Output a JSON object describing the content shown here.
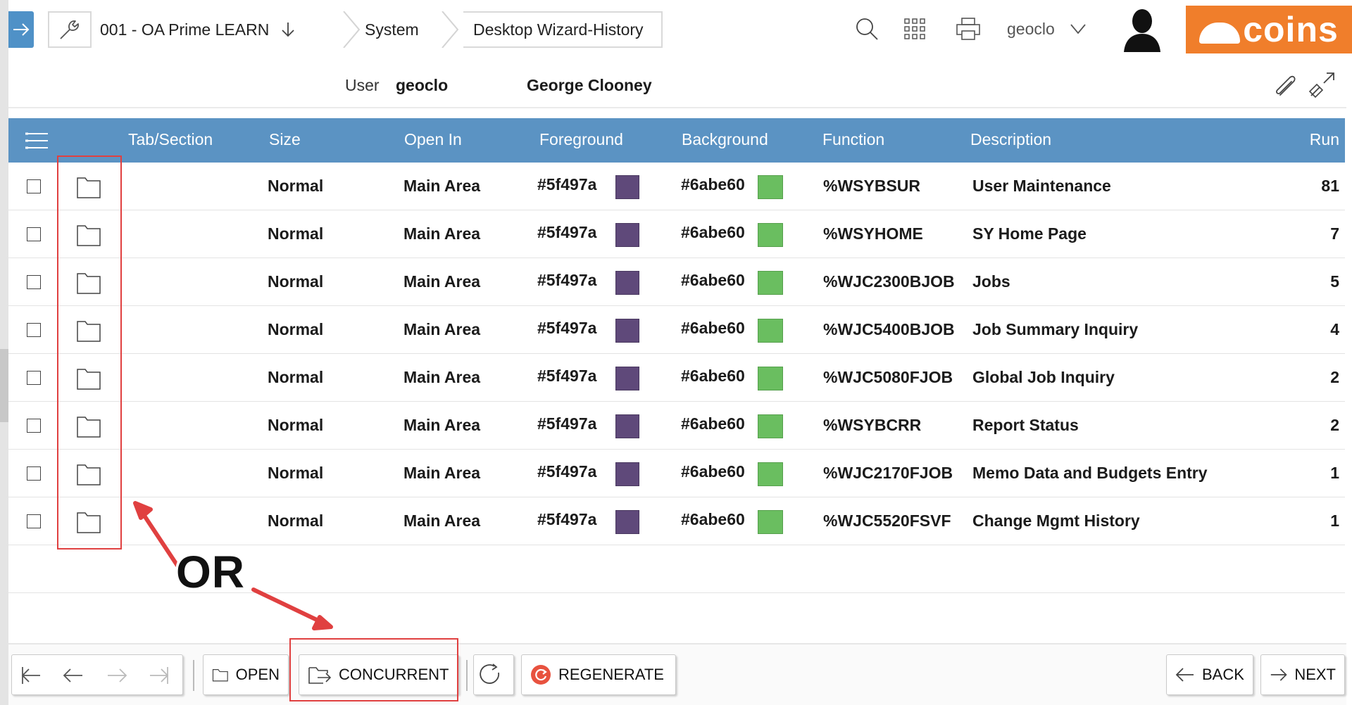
{
  "breadcrumb": {
    "company": "001 - OA Prime LEARN",
    "module": "System",
    "page": "Desktop Wizard-History"
  },
  "header": {
    "user_code": "geoclo",
    "brand": "coins"
  },
  "info": {
    "user_label": "User",
    "user_code": "geoclo",
    "user_name": "George Clooney"
  },
  "grid": {
    "columns": [
      "Tab/Section",
      "Size",
      "Open In",
      "Foreground",
      "Background",
      "Function",
      "Description",
      "Run"
    ],
    "rows": [
      {
        "size": "Normal",
        "open_in": "Main Area",
        "foreground": "#5f497a",
        "background": "#6abe60",
        "function": "%WSYBSUR",
        "description": "User Maintenance",
        "run": "81"
      },
      {
        "size": "Normal",
        "open_in": "Main Area",
        "foreground": "#5f497a",
        "background": "#6abe60",
        "function": "%WSYHOME",
        "description": "SY Home Page",
        "run": "7"
      },
      {
        "size": "Normal",
        "open_in": "Main Area",
        "foreground": "#5f497a",
        "background": "#6abe60",
        "function": "%WJC2300BJOB",
        "description": "Jobs",
        "run": "5"
      },
      {
        "size": "Normal",
        "open_in": "Main Area",
        "foreground": "#5f497a",
        "background": "#6abe60",
        "function": "%WJC5400BJOB",
        "description": "Job Summary Inquiry",
        "run": "4"
      },
      {
        "size": "Normal",
        "open_in": "Main Area",
        "foreground": "#5f497a",
        "background": "#6abe60",
        "function": "%WJC5080FJOB",
        "description": "Global Job Inquiry",
        "run": "2"
      },
      {
        "size": "Normal",
        "open_in": "Main Area",
        "foreground": "#5f497a",
        "background": "#6abe60",
        "function": "%WSYBCRR",
        "description": "Report Status",
        "run": "2"
      },
      {
        "size": "Normal",
        "open_in": "Main Area",
        "foreground": "#5f497a",
        "background": "#6abe60",
        "function": "%WJC2170FJOB",
        "description": "Memo Data and Budgets Entry",
        "run": "1"
      },
      {
        "size": "Normal",
        "open_in": "Main Area",
        "foreground": "#5f497a",
        "background": "#6abe60",
        "function": "%WJC5520FSVF",
        "description": "Change Mgmt History",
        "run": "1"
      }
    ]
  },
  "toolbar": {
    "open": "OPEN",
    "concurrent": "CONCURRENT",
    "regenerate": "REGENERATE",
    "back": "BACK",
    "next": "NEXT"
  },
  "annotation": {
    "text": "OR",
    "color": "#e04040"
  },
  "colors": {
    "accent": "#4f91c7",
    "grid_header": "#5b93c3",
    "brand": "#f07e2b",
    "regenerate_icon": "#e8523f"
  }
}
